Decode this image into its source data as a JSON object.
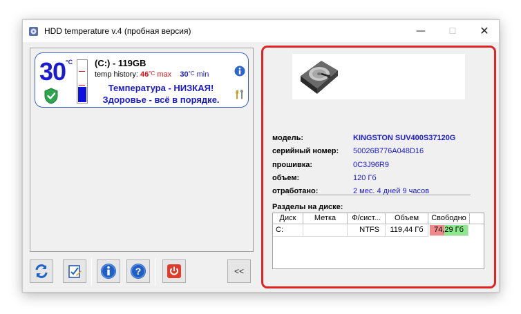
{
  "window": {
    "title": "HDD temperature v.4 (пробная версия)",
    "minimize_icon": "minimize-icon",
    "maximize_icon": "maximize-icon",
    "close_icon": "close-icon"
  },
  "disk_card": {
    "temperature": "30",
    "temperature_unit": "°C",
    "disk_label": "(C:) - 119GB",
    "history_label": "temp history:",
    "history_max": "46",
    "history_max_unit": "°C",
    "history_max_label": "max",
    "history_min": "30",
    "history_min_unit": "°C",
    "history_min_label": "min",
    "status_line1": "Температура - НИЗКАЯ!",
    "status_line2": "Здоровье - всё в порядке.",
    "thermometer_level": 0.35,
    "colors": {
      "temp": "#1a1ad0",
      "max": "#e01010",
      "border": "#3a60c8"
    }
  },
  "toolbar": {
    "buttons": [
      {
        "name": "refresh-button",
        "icon": "refresh-icon"
      },
      {
        "name": "report-button",
        "icon": "report-icon"
      },
      {
        "name": "about-button",
        "icon": "info-icon"
      },
      {
        "name": "help-button",
        "icon": "help-icon"
      },
      {
        "name": "power-button",
        "icon": "power-icon"
      }
    ],
    "collapse_label": "<<"
  },
  "details": {
    "rows": [
      {
        "label": "модель:",
        "value": "KINGSTON SUV400S37120G"
      },
      {
        "label": "серийный номер:",
        "value": "50026B776A048D16"
      },
      {
        "label": "прошивка:",
        "value": "0C3J96R9"
      },
      {
        "label": "объем:",
        "value": "120 Гб"
      },
      {
        "label": "отработано:",
        "value": "2 мес. 4 дней 9 часов"
      }
    ],
    "partitions_title": "Разделы на диске:",
    "table": {
      "headers": [
        "Диск",
        "Метка",
        "Ф/сист...",
        "Объем",
        "Свободно"
      ],
      "rows": [
        {
          "disk": "C:",
          "label": "",
          "fs": "NTFS",
          "size": "119,44 Гб",
          "free": "74,29 Гб",
          "used_fraction": 0.38
        }
      ]
    },
    "colors": {
      "value": "#1a1ad0",
      "highlight_border": "#e02424",
      "free": "#8ee88e",
      "used": "#f08a8a"
    }
  }
}
